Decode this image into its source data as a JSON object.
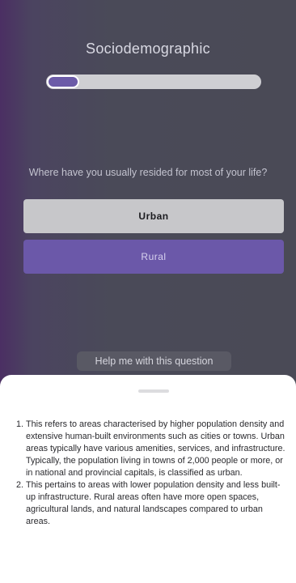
{
  "page": {
    "title": "Sociodemographic",
    "progress": 0.15,
    "question": "Where have you usually resided for most of your life?",
    "options": [
      {
        "label": "Urban"
      },
      {
        "label": "Rural"
      }
    ],
    "help_button_label": "Help me with this question"
  },
  "help_sheet": {
    "items": [
      {
        "number": "1.",
        "text": "This refers to areas characterised by higher population density and extensive human-built environments such as cities or towns. Urban areas typically have various amenities, services, and infrastructure. Typically, the population living in towns of 2,000 people or more, or in national and provincial capitals, is classified as urban."
      },
      {
        "number": "2.",
        "text": "This pertains to areas with lower population density and less built-up infrastructure. Rural areas often have more open spaces, agricultural lands, and natural landscapes compared to urban areas."
      }
    ]
  },
  "colors": {
    "accent": "#6b58a9",
    "background": "#4a4a56",
    "option_neutral": "#c7c7ca",
    "sheet": "#ffffff"
  }
}
